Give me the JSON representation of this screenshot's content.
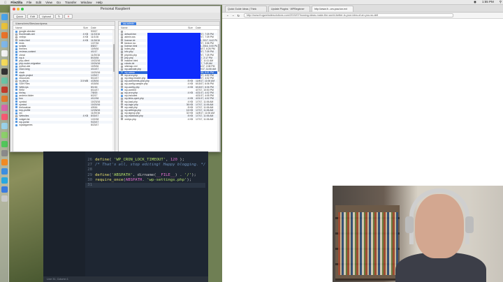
{
  "menubar": {
    "app": "FileZilla",
    "items": [
      "File",
      "Edit",
      "View",
      "Go",
      "Transfer",
      "Window",
      "Help"
    ],
    "clock": "1:55 PM"
  },
  "ftp": {
    "title": "Personal Raspberri",
    "toolbar": [
      "Quick",
      "Edit",
      "Upload"
    ],
    "left_path": "/Users/chris/Sites/wordpress",
    "right_path": "wp-admin",
    "left_columns": [
      "Name",
      "Size",
      "Date"
    ],
    "right_columns": [
      "Name",
      "Size",
      "Date"
    ],
    "left_rows": [
      {
        "name": "google-checker",
        "size": "",
        "date": "9/3/17"
      },
      {
        "name": "thumbnails.xml",
        "size": "4 KB",
        "date": "11/13/16"
      },
      {
        "name": "xmlrpc",
        "size": "4 KB",
        "date": "11/1/16"
      },
      {
        "name": "index.html",
        "size": "4 KB",
        "date": "11/16/16"
      },
      {
        "name": "tests",
        "size": "",
        "date": "1/27/16"
      },
      {
        "name": "scripts",
        "size": "",
        "date": "8/8/17"
      },
      {
        "name": "themes",
        "size": "",
        "date": "10/9/16"
      },
      {
        "name": "reviews-content",
        "size": "",
        "date": "4/1/17"
      },
      {
        "name": "cheat",
        "size": "",
        "date": "11/20/16"
      },
      {
        "name": "wp-k",
        "size": "",
        "date": "8/15/16"
      },
      {
        "name": "php-client",
        "size": "",
        "date": "10/22/16"
      },
      {
        "name": "php-router-migration",
        "size": "",
        "date": "10/24/16"
      },
      {
        "name": "python-ide",
        "size": "",
        "date": "10/9/16"
      },
      {
        "name": "react-lang",
        "size": "",
        "date": "4/10/17"
      },
      {
        "name": "slack",
        "size": "",
        "date": "10/20/16"
      },
      {
        "name": "apple-project",
        "size": "",
        "date": "1/29/17"
      },
      {
        "name": "resources",
        "size": "",
        "date": "5/10/17"
      },
      {
        "name": "vs-dev.js",
        "size": "3.5 MB",
        "date": "4/28/16"
      },
      {
        "name": "SSH Files",
        "size": "",
        "date": "4/18/16"
      },
      {
        "name": "WebLips",
        "size": "",
        "date": "8/1/16"
      },
      {
        "name": "BKM",
        "size": "",
        "date": "6/14/17"
      },
      {
        "name": "bin/sq",
        "size": "",
        "date": "7/8/15"
      },
      {
        "name": "andrew-folder",
        "size": "",
        "date": "6/2/17"
      },
      {
        "name": "bus",
        "size": "",
        "date": "4/12/16"
      },
      {
        "name": "symbol",
        "size": "",
        "date": "10/23/16"
      },
      {
        "name": "symbol",
        "size": "",
        "date": "10/20/16"
      },
      {
        "name": "thelocalvar",
        "size": "",
        "date": "4/9/16"
      },
      {
        "name": "tmp-profile",
        "size": "",
        "date": "12/26/16"
      },
      {
        "name": "src",
        "size": "",
        "date": "11/20/16"
      },
      {
        "name": "Websites",
        "size": "4 KB",
        "date": "8/30/17"
      },
      {
        "name": "widget-list",
        "size": "",
        "date": "1/22/18"
      },
      {
        "name": "wp-portal",
        "size": "",
        "date": "9/20/17"
      },
      {
        "name": "wpaolgames",
        "size": "",
        "date": "8/23/17"
      }
    ],
    "right_rows": [
      {
        "name": "..",
        "size": "",
        "date": "",
        "selected": false
      },
      {
        "name": "default.htm",
        "size": "4 KB",
        "date": "7/10/17, 7:39 PM",
        "selected": false
      },
      {
        "name": "admin.css",
        "size": "4 KB",
        "date": "7/10/17, 7:39 PM",
        "selected": false
      },
      {
        "name": "license.txt",
        "size": "20 KB",
        "date": "Jun 6, 2017, 6:42 PM",
        "selected": false
      },
      {
        "name": "favicon.ico",
        "size": "4 KB",
        "date": "5/20/17, 3:56 PM",
        "selected": false
      },
      {
        "name": "license.html",
        "size": "19 KB",
        "date": "Apr 6, 2016, 3:00 PM",
        "selected": false
      },
      {
        "name": "index.php",
        "size": "4 KB",
        "date": "10/25/17, 6:26 PM",
        "selected": false
      },
      {
        "name": "info.php",
        "size": "4 KB",
        "date": "7/10/17, 7:39 PM",
        "selected": false
      },
      {
        "name": "phpinfo.php",
        "size": "4 KB",
        "date": "7/10/17, 7:39 PM",
        "selected": false
      },
      {
        "name": "php.php",
        "size": "4 KB",
        "date": "8/1/17, 2:17 PM",
        "selected": false
      },
      {
        "name": "readme.html",
        "size": "4 KB",
        "date": "8/1/17, 11:11 AM",
        "selected": false
      },
      {
        "name": "robots.txt",
        "size": "4 KB",
        "date": "8/1/17, 7:49 AM",
        "selected": false
      },
      {
        "name": "sitemap.xml",
        "size": "4 KB",
        "date": "10/11/17, 2:08 PM",
        "selected": false
      },
      {
        "name": "wp-activate.php",
        "size": "8 KB",
        "date": "11/17/17, 11:06 AM",
        "selected": false
      },
      {
        "name": "wp-admin",
        "size": "",
        "date": "2/12/18, 8:01 PM",
        "selected": true
      },
      {
        "name": "wp-cron.php",
        "size": "20 KB",
        "date": "4/21/17, 4:02 PM",
        "selected": false
      },
      {
        "name": "wp-blog-header.php",
        "size": "4 KB",
        "date": "4/21/17, 4:02 PM",
        "selected": false
      },
      {
        "name": "wp-comments-post.php",
        "size": "8 KB",
        "date": "11/8/17, 11:06 AM",
        "selected": false
      },
      {
        "name": "wp-config-sample.php",
        "size": "4 KB",
        "date": "6/15/17, 6:06 PM",
        "selected": false
      },
      {
        "name": "wp-config.php",
        "size": "4 KB",
        "date": "6/15/17, 6:06 PM",
        "selected": false
      },
      {
        "name": "wp-content",
        "size": "",
        "date": "4/7/17, 10:53 PM",
        "selected": false
      },
      {
        "name": "wp-cron.php",
        "size": "4 KB",
        "date": "4/21/17, 4:02 PM",
        "selected": false
      },
      {
        "name": "wp-includes",
        "size": "",
        "date": "4/21/17, 4:05 PM",
        "selected": false
      },
      {
        "name": "wp-links-opml.php",
        "size": "4 KB",
        "date": "4/21/17, 4:02 PM",
        "selected": false
      },
      {
        "name": "wp-load.php",
        "size": "4 KB",
        "date": "1/7/17, 11:06 AM",
        "selected": false
      },
      {
        "name": "wp-login.php",
        "size": "36 KB",
        "date": "1/7/17, 11:06 AM",
        "selected": false
      },
      {
        "name": "wp-mail.php",
        "size": "8 KB",
        "date": "1/7/17, 11:06 AM",
        "selected": false
      },
      {
        "name": "wp-settings.php",
        "size": "16 KB",
        "date": "1/7/17, 11:06 AM",
        "selected": false
      },
      {
        "name": "wp-signup.php",
        "size": "32 KB",
        "date": "11/8/17, 11:06 AM",
        "selected": false
      },
      {
        "name": "wp-trackback.php",
        "size": "8 KB",
        "date": "1/7/17, 11:06 AM",
        "selected": false
      },
      {
        "name": "xmlrpc.php",
        "size": "4 KB",
        "date": "1/7/17, 11:06 AM",
        "selected": false
      }
    ]
  },
  "browser": {
    "tabs": [
      "Quick Guide Ideas | Think",
      "Update Plugins · WPBeginner",
      "http://www.fr...om-pow.ion.ext"
    ],
    "url": "http://www.frogwebsitesolutions.com/2015/07/loosing-ideas-make-the-world-better-is-your-idea-of-an-you-ss-dell"
  },
  "editor": {
    "lines": [
      {
        "n": "26",
        "tokens": [
          [
            "fn",
            "define"
          ],
          [
            "plain",
            "( "
          ],
          [
            "str",
            "'WP_CRON_LOCK_TIMEOUT'"
          ],
          [
            "plain",
            ", "
          ],
          [
            "const",
            "120"
          ],
          [
            "plain",
            " );"
          ]
        ]
      },
      {
        "n": "27",
        "tokens": [
          [
            "com",
            "/* That's all, stop editing! Happy blogging. */"
          ]
        ]
      },
      {
        "n": "28",
        "tokens": []
      },
      {
        "n": "29",
        "tokens": [
          [
            "fn",
            "define"
          ],
          [
            "plain",
            "("
          ],
          [
            "str",
            "'ABSPATH'"
          ],
          [
            "plain",
            ", dirname("
          ],
          [
            "const",
            "__FILE__"
          ],
          [
            "plain",
            ") . "
          ],
          [
            "str",
            "'/'"
          ],
          [
            "plain",
            ");"
          ]
        ]
      },
      {
        "n": "30",
        "tokens": [
          [
            "fn",
            "require_once"
          ],
          [
            "plain",
            "("
          ],
          [
            "const",
            "ABSPATH"
          ],
          [
            "plain",
            ". "
          ],
          [
            "str",
            "'wp-settings.php'"
          ],
          [
            "plain",
            ");"
          ]
        ]
      },
      {
        "n": "31",
        "tokens": []
      }
    ],
    "status": "Line 31, Column 1"
  },
  "colors": {
    "selection": "#2d6ad6",
    "censor": "#0e2cfc",
    "editor_bg": "#1e2632"
  }
}
